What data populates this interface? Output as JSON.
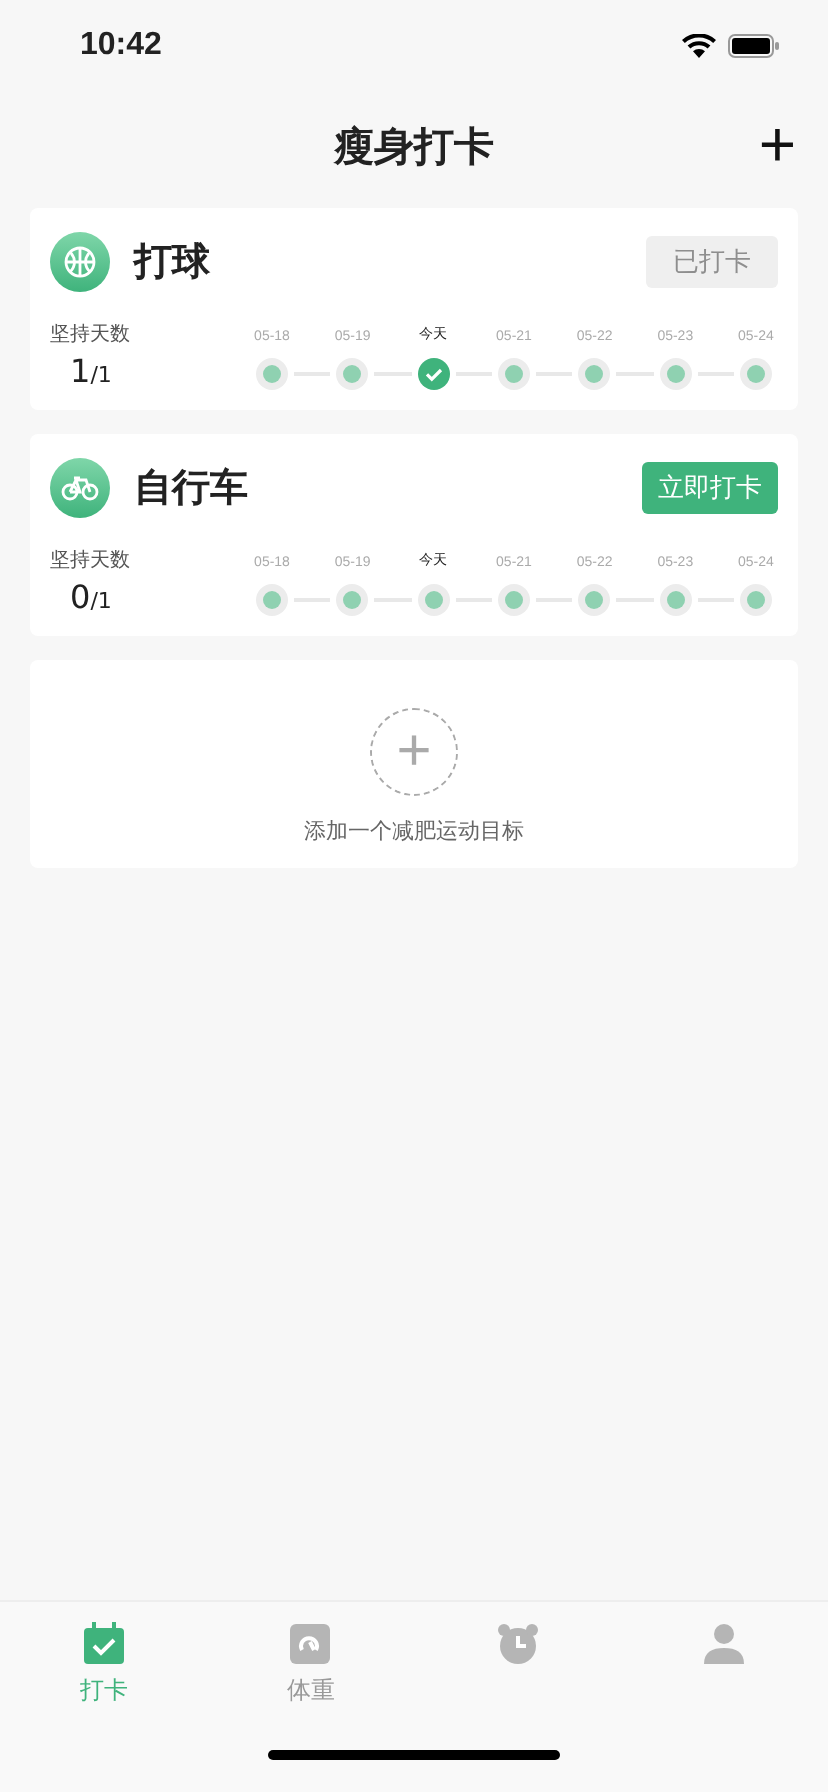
{
  "status_bar": {
    "time": "10:42"
  },
  "header": {
    "title": "瘦身打卡",
    "add": "+"
  },
  "goals": [
    {
      "name": "打球",
      "kind": "ball",
      "button": {
        "label": "已打卡",
        "done": true
      },
      "streak_label": "坚持天数",
      "streak": "1",
      "total": "/1",
      "days": [
        {
          "label": "05-18",
          "today": false,
          "checked": false
        },
        {
          "label": "05-19",
          "today": false,
          "checked": false
        },
        {
          "label": "今天",
          "today": true,
          "checked": true
        },
        {
          "label": "05-21",
          "today": false,
          "checked": false
        },
        {
          "label": "05-22",
          "today": false,
          "checked": false
        },
        {
          "label": "05-23",
          "today": false,
          "checked": false
        },
        {
          "label": "05-24",
          "today": false,
          "checked": false
        }
      ]
    },
    {
      "name": "自行车",
      "kind": "bike",
      "button": {
        "label": "立即打卡",
        "done": false
      },
      "streak_label": "坚持天数",
      "streak": "0",
      "total": "/1",
      "days": [
        {
          "label": "05-18",
          "today": false,
          "checked": false
        },
        {
          "label": "05-19",
          "today": false,
          "checked": false
        },
        {
          "label": "今天",
          "today": true,
          "checked": false
        },
        {
          "label": "05-21",
          "today": false,
          "checked": false
        },
        {
          "label": "05-22",
          "today": false,
          "checked": false
        },
        {
          "label": "05-23",
          "today": false,
          "checked": false
        },
        {
          "label": "05-24",
          "today": false,
          "checked": false
        }
      ]
    }
  ],
  "add_goal": {
    "plus": "+",
    "label": "添加一个减肥运动目标"
  },
  "tab_bar": [
    {
      "kind": "checkin",
      "label": "打卡",
      "selected": true
    },
    {
      "kind": "weight",
      "label": "体重",
      "selected": false
    },
    {
      "kind": "alarm",
      "selected": false
    },
    {
      "kind": "profile",
      "selected": false
    }
  ]
}
